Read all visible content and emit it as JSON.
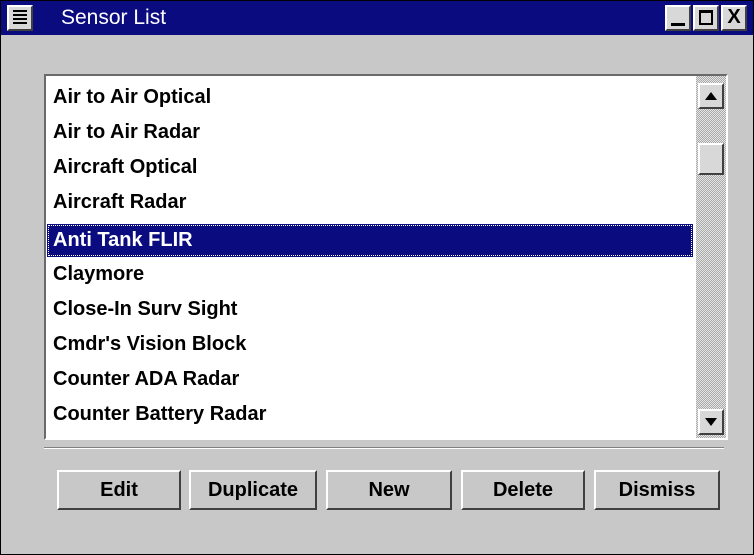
{
  "window": {
    "title": "Sensor List",
    "menu_icon": "window-menu-icon",
    "controls": {
      "minimize": "minimize-icon",
      "maximize": "maximize-icon",
      "close_label": "X"
    }
  },
  "sensor_list": {
    "items": [
      "Air to Air Optical",
      "Air to Air Radar",
      "Aircraft Optical",
      "Aircraft Radar",
      "Anti Tank FLIR",
      "Claymore",
      "Close-In Surv Sight",
      "Cmdr's Vision Block",
      "Counter ADA Radar",
      "Counter Battery Radar"
    ],
    "selected_index": 4,
    "colors": {
      "selection_bg": "#0b0b80",
      "selection_text": "#ffffff"
    }
  },
  "buttons": {
    "edit": "Edit",
    "duplicate": "Duplicate",
    "new": "New",
    "delete": "Delete",
    "dismiss": "Dismiss"
  }
}
